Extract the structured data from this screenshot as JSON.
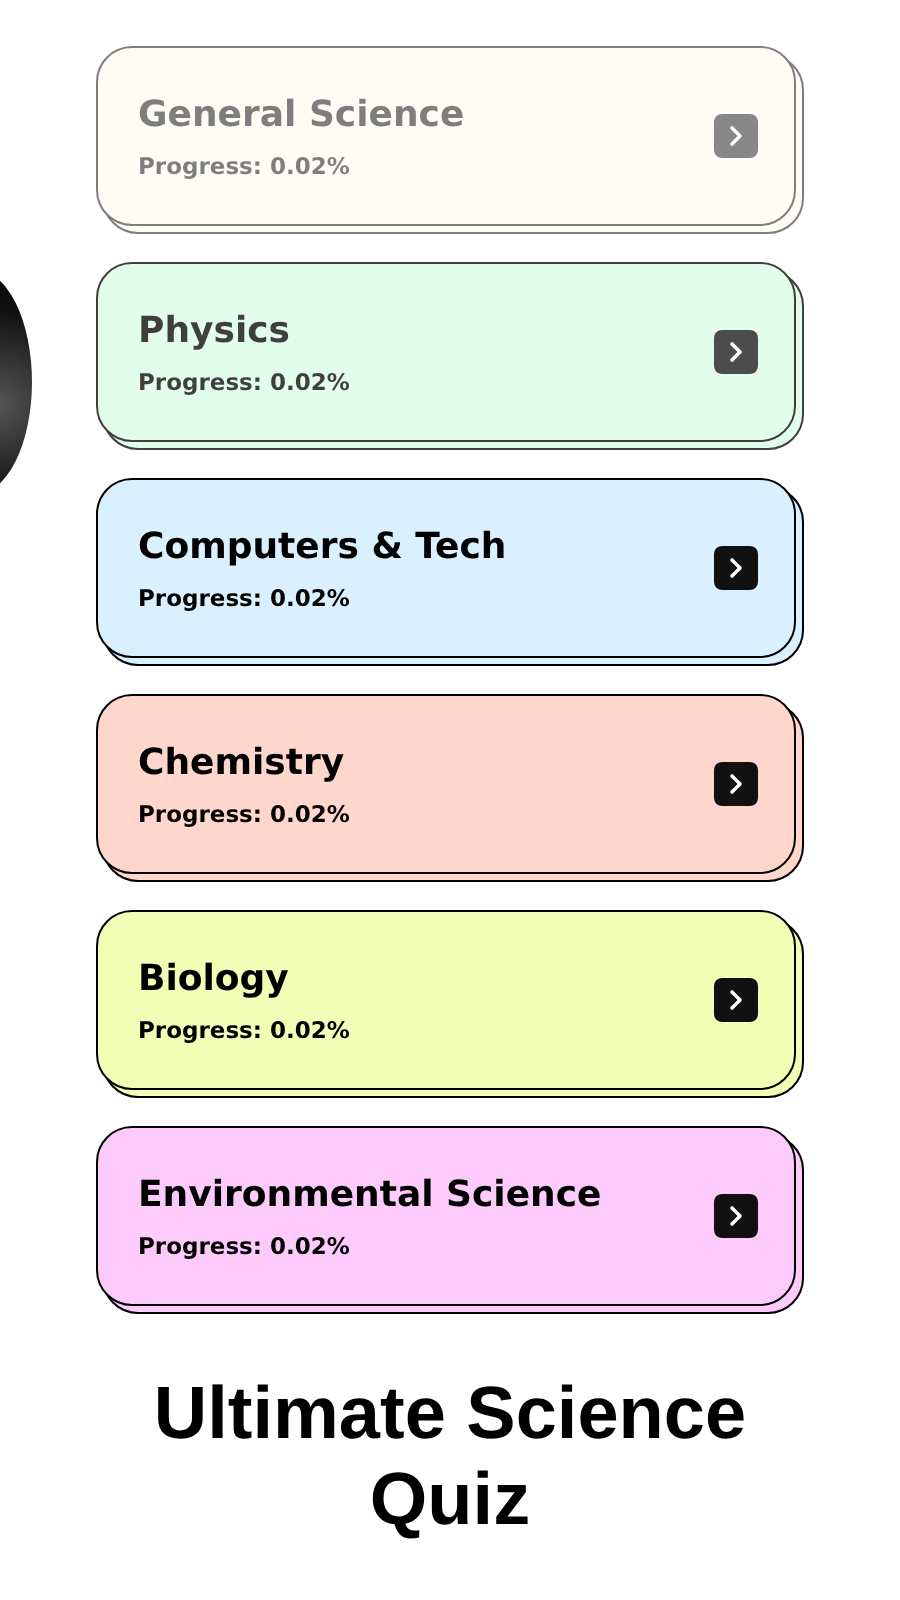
{
  "categories": [
    {
      "title": "General Science",
      "progress": "Progress: 0.02%",
      "color": "#fff8ec",
      "kind": "faded"
    },
    {
      "title": "Physics",
      "progress": "Progress: 0.02%",
      "color": "#d9fde6",
      "kind": "dim"
    },
    {
      "title": "Computers & Tech",
      "progress": "Progress: 0.02%",
      "color": "#dbf0ff",
      "kind": "plain"
    },
    {
      "title": "Chemistry",
      "progress": "Progress: 0.02%",
      "color": "#ffd6cc",
      "kind": "plain"
    },
    {
      "title": "Biology",
      "progress": "Progress: 0.02%",
      "color": "#f2fdb6",
      "kind": "plain"
    },
    {
      "title": "Environmental Science",
      "progress": "Progress: 0.02%",
      "color": "#fdcbfb",
      "kind": "plain"
    }
  ],
  "app_title": "Ultimate Science Quiz"
}
